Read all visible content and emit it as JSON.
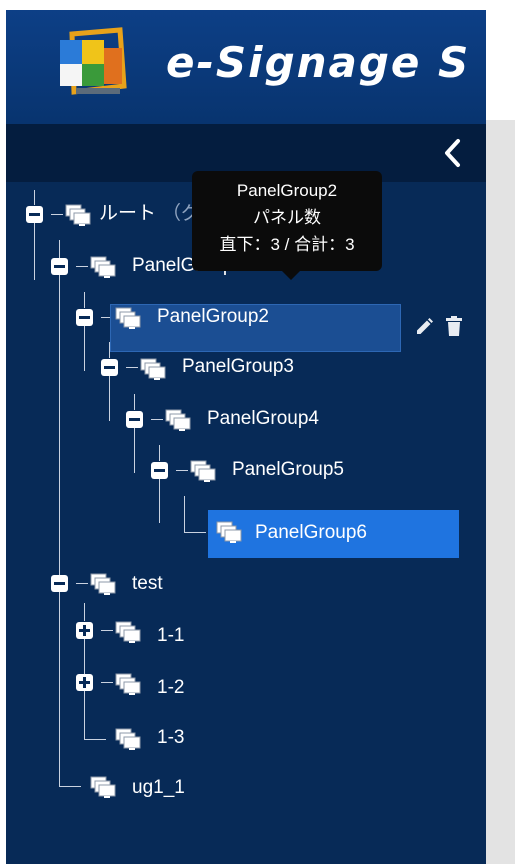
{
  "app": {
    "title": "e-Signage S"
  },
  "sidebar": {
    "collapse_icon": "chevron-left-icon"
  },
  "tree": {
    "root": {
      "label": "ルート",
      "group_hint": "（グループなし）"
    },
    "nodes": [
      {
        "label": "PanelGroup1",
        "state": "expanded"
      },
      {
        "label": "PanelGroup2",
        "state": "expanded",
        "selected": true
      },
      {
        "label": "PanelGroup3",
        "state": "expanded"
      },
      {
        "label": "PanelGroup4",
        "state": "expanded"
      },
      {
        "label": "PanelGroup5",
        "state": "expanded"
      },
      {
        "label": "PanelGroup6",
        "state": "leaf",
        "active": true
      },
      {
        "label": "test",
        "state": "expanded"
      },
      {
        "label": "1-1",
        "state": "collapsed"
      },
      {
        "label": "1-2",
        "state": "collapsed"
      },
      {
        "label": "1-3",
        "state": "leaf"
      },
      {
        "label": "ug1_1",
        "state": "leaf"
      }
    ],
    "row_actions": {
      "edit_icon": "pencil-icon",
      "delete_icon": "trash-icon"
    }
  },
  "tooltip": {
    "line1": "PanelGroup2",
    "line2": "パネル数",
    "line3": "直下：3 / 合計：3"
  },
  "colors": {
    "sidebar_bg": "#072a57",
    "header_bg": "#0d3f86",
    "selected_bg": "#1b4e93",
    "active_bg": "#1f74e0",
    "tooltip_bg": "#0b0b0b"
  }
}
